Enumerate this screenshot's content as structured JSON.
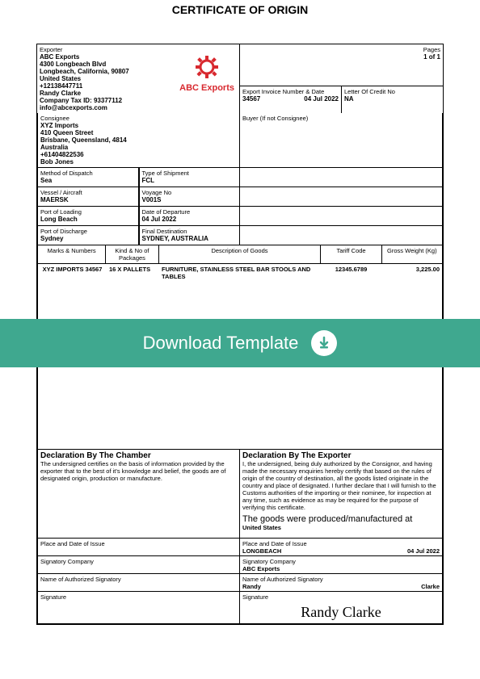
{
  "title": "CERTIFICATE OF ORIGIN",
  "pages": {
    "label": "Pages",
    "value": "1 of 1"
  },
  "exporter": {
    "label": "Exporter",
    "name": "ABC Exports",
    "addr1": "4300 Longbeach Blvd",
    "addr2": "Longbeach, California, 90807",
    "country": "United States",
    "phone": "+12138447711",
    "contact": "Randy Clarke",
    "taxid": "Company Tax ID: 93377112",
    "email": "info@abcexports.com",
    "logo_text": "ABC Exports"
  },
  "invoice": {
    "label": "Export Invoice Number & Date",
    "number": "34567",
    "date": "04 Jul 2022"
  },
  "loc": {
    "label": "Letter Of Credit No",
    "value": "NA"
  },
  "consignee": {
    "label": "Consignee",
    "name": "XYZ Imports",
    "addr1": "410 Queen Street",
    "addr2": "Brisbane, Queensland, 4814",
    "country": "Australia",
    "phone": "+61404822536",
    "contact": "Bob Jones"
  },
  "buyer": {
    "label": "Buyer (If not Consignee)"
  },
  "dispatch": {
    "label": "Method of Dispatch",
    "value": "Sea"
  },
  "shiptype": {
    "label": "Type of Shipment",
    "value": "FCL"
  },
  "vessel": {
    "label": "Vessel / Aircraft",
    "value": "MAERSK"
  },
  "voyage": {
    "label": "Voyage No",
    "value": "V001S"
  },
  "pol": {
    "label": "Port of Loading",
    "value": "Long Beach"
  },
  "dod": {
    "label": "Date of Departure",
    "value": "04 Jul 2022"
  },
  "pod": {
    "label": "Port of Discharge",
    "value": "Sydney"
  },
  "fdest": {
    "label": "Final Destination",
    "value": "SYDNEY, AUSTRALIA"
  },
  "headers": {
    "marks": "Marks & Numbers",
    "kind": "Kind & No of Packages",
    "desc": "Description of Goods",
    "tariff": "Tariff Code",
    "weight": "Gross Weight (Kg)"
  },
  "line": {
    "marks": "XYZ IMPORTS 34567",
    "kind": "16 X PALLETS",
    "desc": "FURNITURE, STAINLESS STEEL BAR STOOLS AND TABLES",
    "tariff": "12345.6789",
    "weight": "3,225.00"
  },
  "banner": {
    "text": "Download Template"
  },
  "chamber": {
    "head": "Declaration By The Chamber",
    "body": "The undersigned certifies on the basis of information provided by the exporter that to the best of it's knowledge and belief, the goods are of designated origin, production or manufacture."
  },
  "exporter_decl": {
    "head": "Declaration By The Exporter",
    "body": "I, the undersigned, being duly authorized by the Consignor, and having made the necessary enquiries hereby certify that based on the rules of origin of the country of destination, all the goods listed originate in the country and place of designated. I further declare that I will furnish to the Customs authorities of the importing or their nominee, for inspection at any time, such as evidence as may be required for the purpose of verifying this certificate.",
    "produced": "The goods were produced/manufactured at",
    "country": "United States"
  },
  "place_issue": {
    "label": "Place and Date of Issue",
    "place": "LONGBEACH",
    "date": "04 Jul 2022"
  },
  "sig_company": {
    "label": "Signatory Company",
    "value": "ABC Exports"
  },
  "auth_sig": {
    "label": "Name of Authorized Signatory",
    "first": "Randy",
    "last": "Clarke"
  },
  "signature": {
    "label": "Signature",
    "value": "Randy Clarke"
  }
}
